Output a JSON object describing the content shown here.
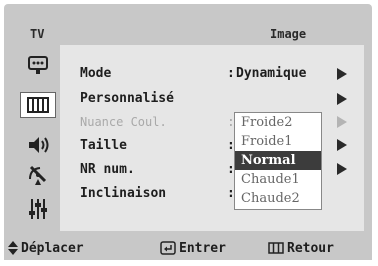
{
  "header": {
    "tv_label": "TV",
    "title": "Image"
  },
  "sidebar": {
    "icons": [
      "input-icon",
      "picture-icon",
      "sound-icon",
      "channel-icon",
      "setup-icon"
    ],
    "active_index": 1
  },
  "menu": {
    "rows": [
      {
        "label": "Mode",
        "value": "Dynamique",
        "enabled": true
      },
      {
        "label": "Personnalisé",
        "value": "",
        "enabled": true
      },
      {
        "label": "Nuance Coul.",
        "value": "",
        "enabled": false
      },
      {
        "label": "Taille",
        "value": "",
        "enabled": true
      },
      {
        "label": "NR num.",
        "value": "",
        "enabled": true
      },
      {
        "label": "Inclinaison",
        "value": "",
        "enabled": true
      }
    ]
  },
  "dropdown": {
    "options": [
      "Froide2",
      "Froide1",
      "Normal",
      "Chaude1",
      "Chaude2"
    ],
    "selected": "Normal"
  },
  "footer": {
    "move_label": "Déplacer",
    "enter_label": "Entrer",
    "return_label": "Retour"
  },
  "colors": {
    "panel": "#e6e6e6",
    "frame": "#c8c8c8",
    "highlight": "#3c3c3c"
  }
}
